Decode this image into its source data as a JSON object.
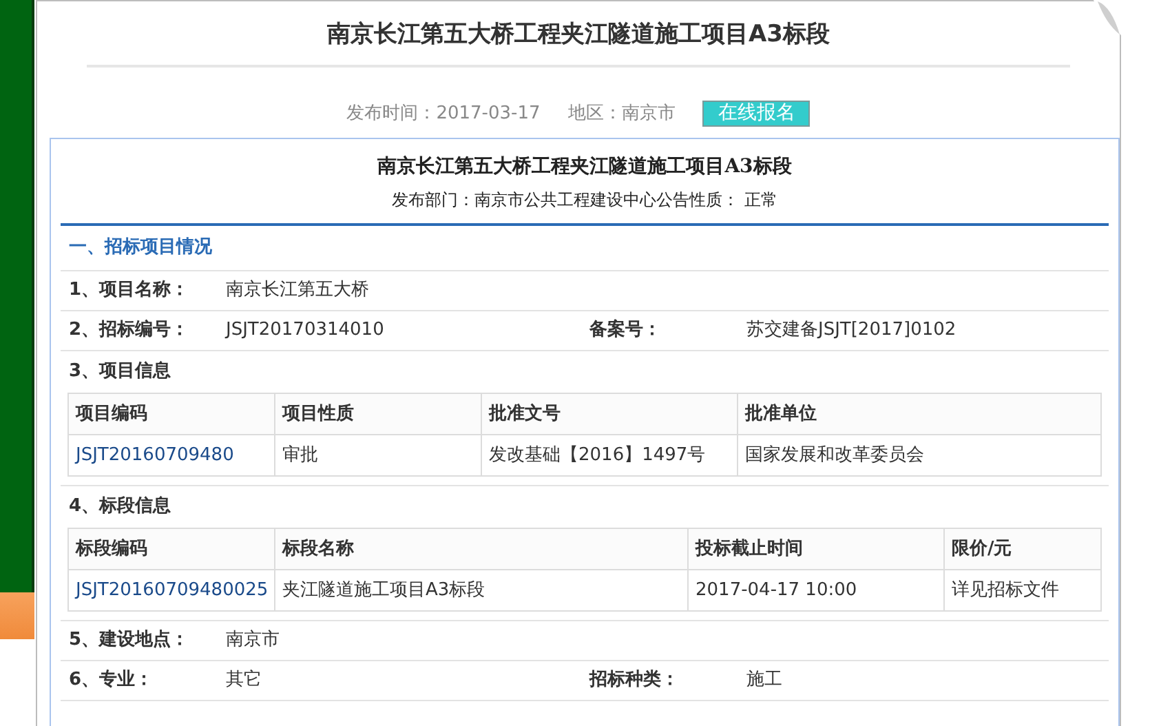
{
  "title": "南京长江第五大桥工程夹江隧道施工项目A3标段",
  "meta": {
    "date_label": "发布时间：",
    "date": "2017-03-17",
    "region_label": "地区：",
    "region": "南京市",
    "signup_button": "在线报名"
  },
  "notice": {
    "title": "南京长江第五大桥工程夹江隧道施工项目A3标段",
    "dept_line": "发布部门：南京市公共工程建设中心公告性质： 正常"
  },
  "section_heading": "一、招标项目情况",
  "items": [
    {
      "kind": "field",
      "label": "1、项目名称：",
      "value": "南京长江第五大桥"
    },
    {
      "kind": "field",
      "label": "2、招标编号：",
      "value": "JSJT20170314010",
      "label2": "备案号：",
      "value2": "苏交建备JSJT[2017]0102"
    },
    {
      "kind": "table",
      "label": "3、项目信息",
      "columns": [
        "项目编码",
        "项目性质",
        "批准文号",
        "批准单位"
      ],
      "rows": [
        [
          "JSJT20160709480",
          "审批",
          "发改基础【2016】1497号",
          "国家发展和改革委员会"
        ]
      ]
    },
    {
      "kind": "table",
      "label": "4、标段信息",
      "columns": [
        "标段编码",
        "标段名称",
        "投标截止时间",
        "限价/元"
      ],
      "rows": [
        [
          "JSJT20160709480025",
          "夹江隧道施工项目A3标段",
          "2017-04-17 10:00",
          "详见招标文件"
        ]
      ]
    },
    {
      "kind": "field",
      "label": "5、建设地点：",
      "value": "南京市"
    },
    {
      "kind": "field",
      "label": "6、专业：",
      "value": "其它",
      "label2": "招标种类：",
      "value2": "施工"
    }
  ]
}
